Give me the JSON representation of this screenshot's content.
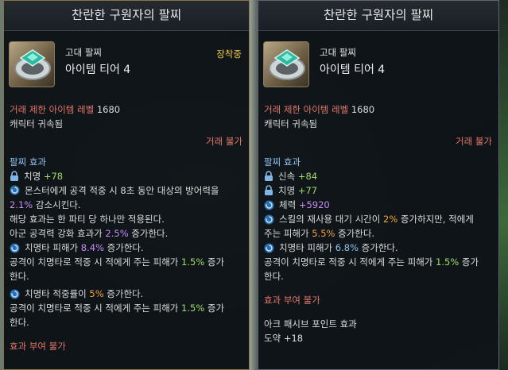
{
  "left": {
    "title": "찬란한 구원자의 팔찌",
    "grade": "고대 팔찌",
    "tier": "아이템 티어 4",
    "equipped": "장착중",
    "trade_level_label": "거래 제한 아이템 레벨",
    "trade_level_value": "1680",
    "bound": "캐릭터 귀속됨",
    "untradable": "거래 불가",
    "effects_header": "팔찌 효과",
    "stat1_name": "치명",
    "stat1_value": "+78",
    "eff1_a": "몬스터에게 공격 적중 시 8초 동안 대상의 방어력을",
    "eff1_pct": "2.1%",
    "eff1_b": " 감소시킨다.",
    "eff1_c": "해당 효과는 한 파티 당 하나만 적용된다.",
    "eff1_d": "아군 공격력 강화 효과가 ",
    "eff1_pct2": "2.5%",
    "eff1_e": " 증가한다.",
    "eff2_a": "치명타 피해가 ",
    "eff2_pct": "8.4%",
    "eff2_b": " 증가한다.",
    "eff2_c": "공격이 치명타로 적중 시 적에게 주는 피해가 ",
    "eff2_pct2": "1.5%",
    "eff2_d": " 증가한다.",
    "eff3_a": "치명타 적중률이 ",
    "eff3_pct": "5%",
    "eff3_b": " 증가한다.",
    "eff3_c": "공격이 치명타로 적중 시 적에게 주는 피해가 ",
    "eff3_pct2": "1.5%",
    "eff3_d": " 증가한다.",
    "enchant": "효과 부여 불가"
  },
  "right": {
    "title": "찬란한 구원자의 팔찌",
    "grade": "고대 팔찌",
    "tier": "아이템 티어 4",
    "trade_level_label": "거래 제한 아이템 레벨",
    "trade_level_value": "1680",
    "bound": "캐릭터 귀속됨",
    "untradable": "거래 불가",
    "effects_header": "팔찌 효과",
    "stat1_name": "신속",
    "stat1_value": "+84",
    "stat2_name": "치명",
    "stat2_value": "+77",
    "stat3_name": "체력",
    "stat3_value": "+5920",
    "eff1_a": "스킬의 재사용 대기 시간이 ",
    "eff1_pct": "2%",
    "eff1_b": " 증가하지만, 적에게 주는 피해가 ",
    "eff1_pct2": "5.5%",
    "eff1_c": " 증가한다.",
    "eff2_a": "치명타 피해가 ",
    "eff2_pct": "6.8%",
    "eff2_b": " 증가한다.",
    "eff2_c": "공격이 치명타로 적중 시 적에게 주는 피해가 ",
    "eff2_pct2": "1.5%",
    "eff2_d": " 증가한다.",
    "enchant": "효과 부여 불가",
    "ark_header": "아크 패시브 포인트 효과",
    "ark_value": "도약 +18"
  }
}
